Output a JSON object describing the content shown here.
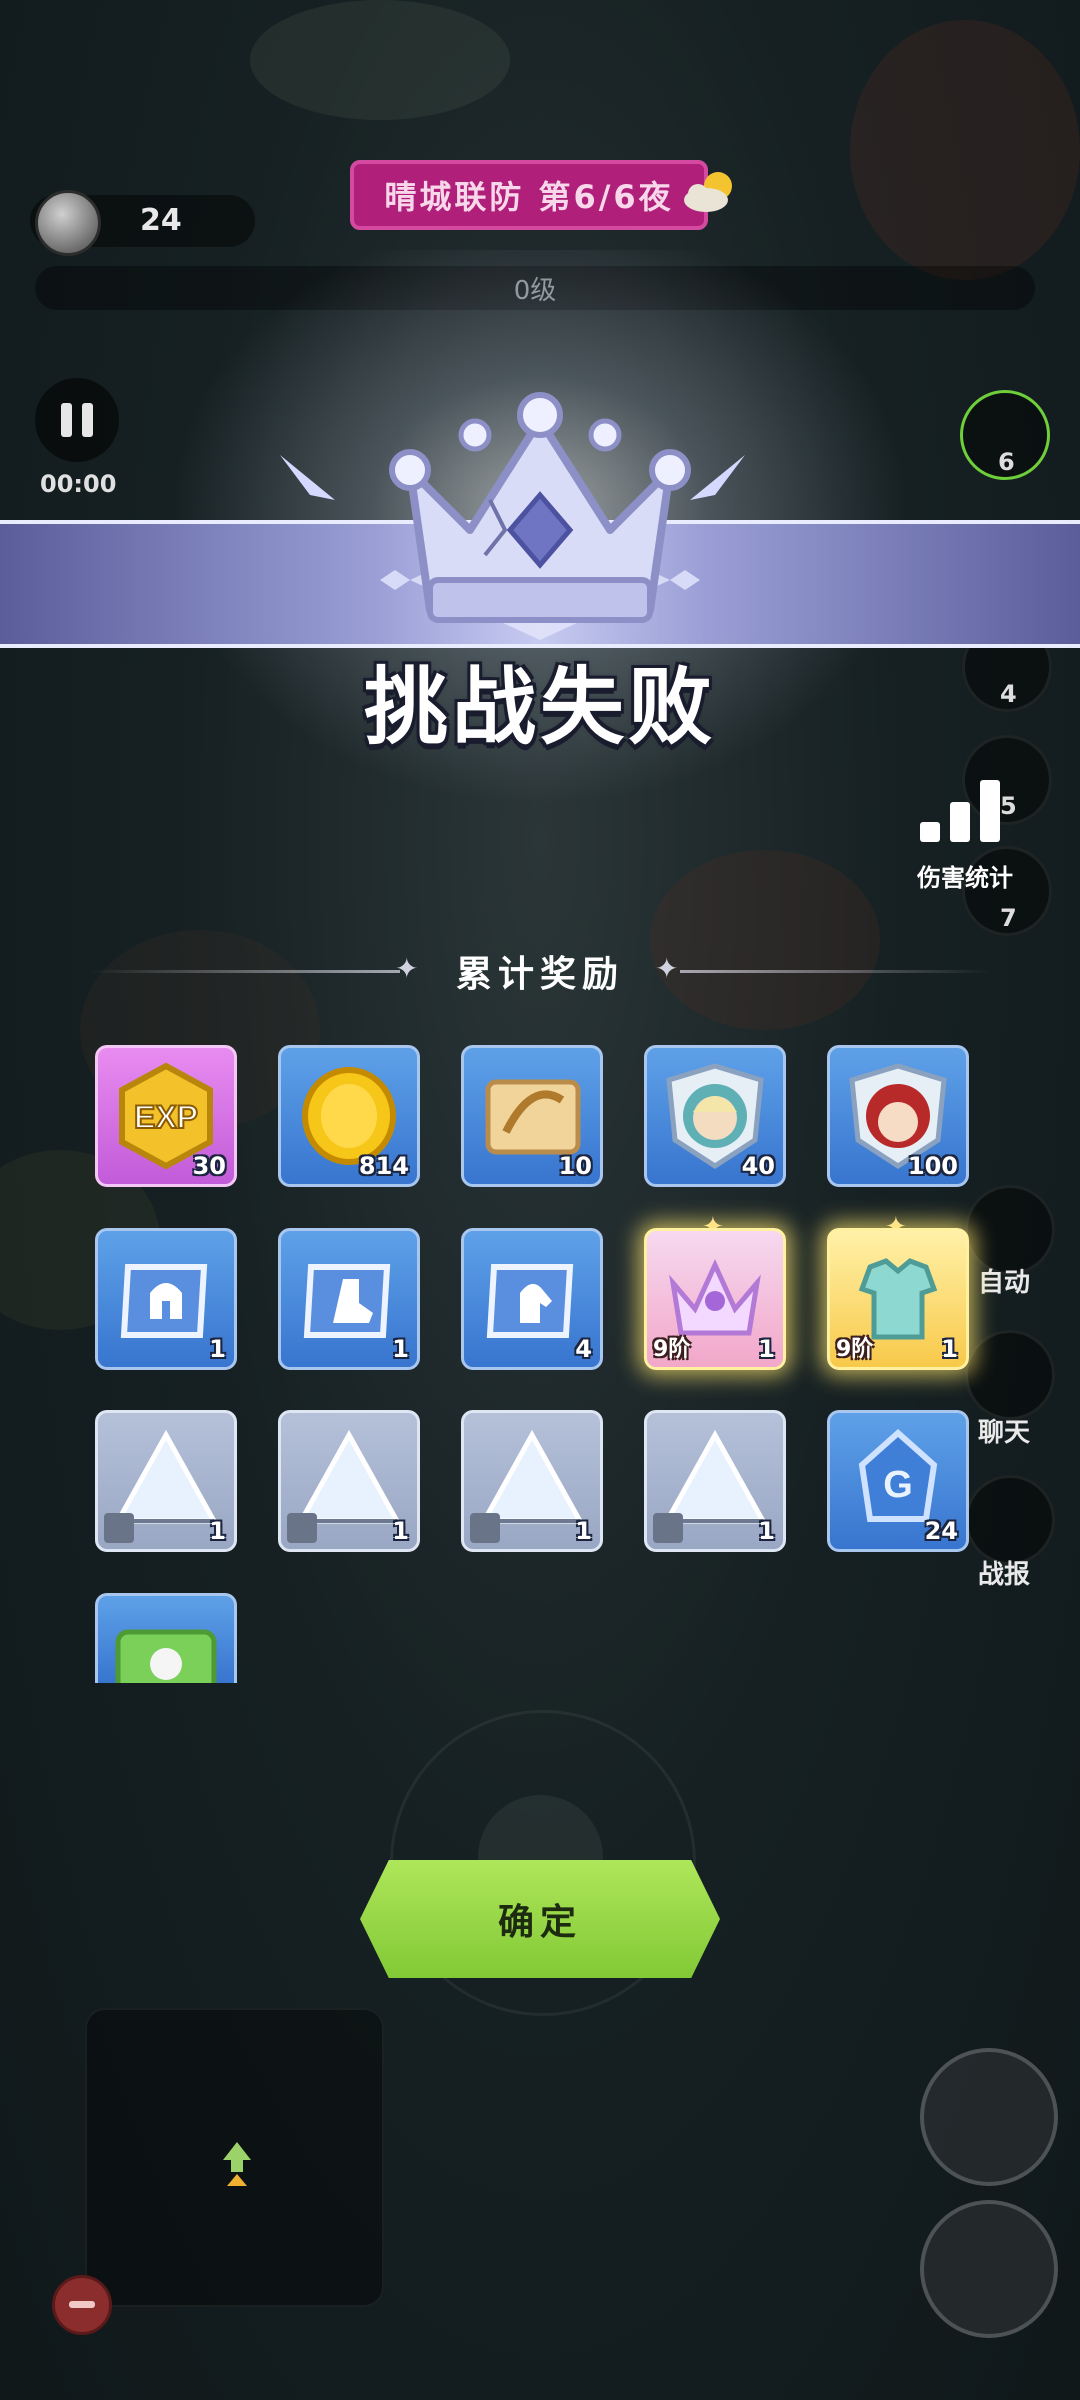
{
  "hud": {
    "coin_count": "24",
    "banner": "晴城联防 第6/6夜",
    "level": "0级",
    "timer": "00:00",
    "side_numbers": [
      "6",
      "4",
      "5",
      "7"
    ]
  },
  "result": {
    "title": "挑战失败",
    "damage_stats_label": "伤害统计"
  },
  "rewards": {
    "title": "累计奖励",
    "rows": [
      [
        {
          "icon": "exp-icon",
          "count": "30",
          "style": "purple"
        },
        {
          "icon": "gold-coin-icon",
          "count": "814",
          "style": "blue"
        },
        {
          "icon": "bow-scroll-icon",
          "count": "10",
          "style": "blue"
        },
        {
          "icon": "hero-portrait-icon",
          "count": "40",
          "style": "blue"
        },
        {
          "icon": "red-hood-hero-icon",
          "count": "100",
          "style": "blue"
        }
      ],
      [
        {
          "icon": "helmet-scroll-icon",
          "count": "1",
          "style": "blue"
        },
        {
          "icon": "boot-scroll-icon",
          "count": "1",
          "style": "blue"
        },
        {
          "icon": "glove-scroll-icon",
          "count": "4",
          "style": "blue"
        },
        {
          "icon": "crown-equipment-icon",
          "count": "1",
          "grade": "9阶",
          "style": "gold"
        },
        {
          "icon": "armor-equipment-icon",
          "count": "1",
          "grade": "9阶",
          "style": "gold2"
        }
      ],
      [
        {
          "icon": "clothes-shard-icon",
          "count": "1",
          "style": "gray"
        },
        {
          "icon": "boot-shard-icon",
          "count": "1",
          "style": "gray"
        },
        {
          "icon": "glove-shard-icon",
          "count": "1",
          "style": "gray"
        },
        {
          "icon": "hand-shard-icon",
          "count": "1",
          "style": "gray"
        },
        {
          "icon": "blue-gem-icon",
          "count": "24",
          "style": "blue"
        }
      ],
      [
        {
          "icon": "green-ticket-icon",
          "count": "",
          "style": "blue"
        }
      ]
    ]
  },
  "side_menu": {
    "auto": "自动",
    "chat": "聊天",
    "report": "战报"
  },
  "confirm_button": "确定"
}
